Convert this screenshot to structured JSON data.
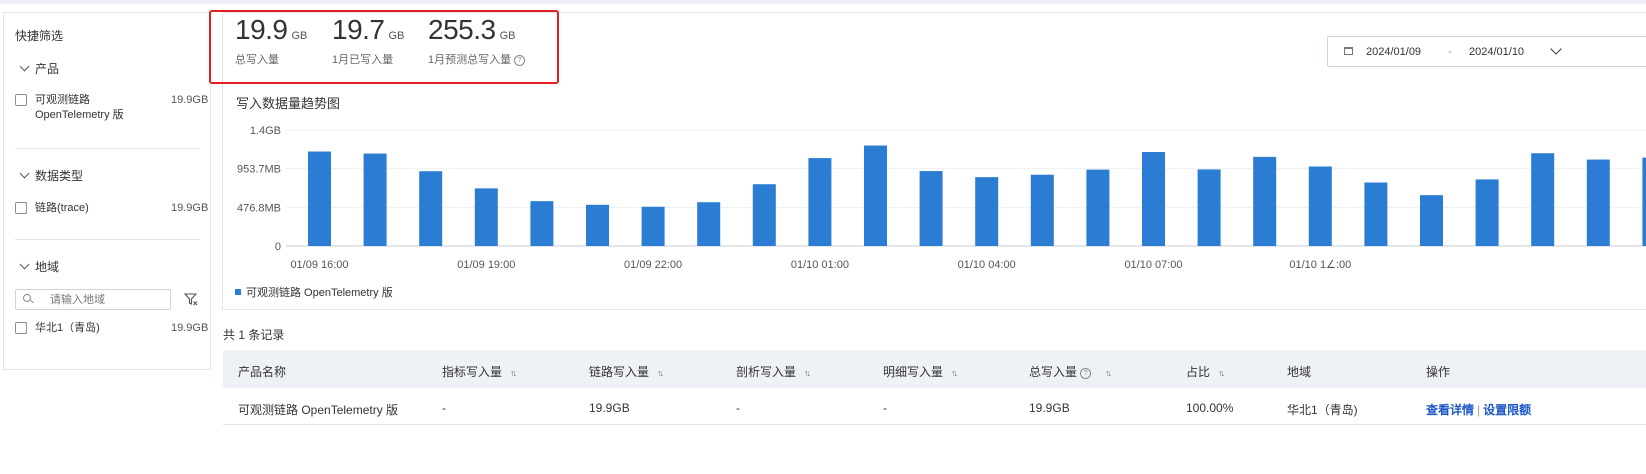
{
  "sidebar": {
    "title": "快捷筛选",
    "sections": [
      {
        "title": "产品",
        "items": [
          {
            "label_line1": "可观测链路",
            "label_line2": "OpenTelemetry 版",
            "count": "19.9GB"
          }
        ]
      },
      {
        "title": "数据类型",
        "items": [
          {
            "label": "链路(trace)",
            "count": "19.9GB"
          }
        ]
      },
      {
        "title": "地域",
        "search_placeholder": "请输入地域",
        "items": [
          {
            "label": "华北1（青岛)",
            "count": "19.9GB"
          }
        ]
      }
    ]
  },
  "stats": [
    {
      "value": "19.9",
      "unit": "GB",
      "label": "总写入量"
    },
    {
      "value": "19.7",
      "unit": "GB",
      "label": "1月已写入量"
    },
    {
      "value": "255.3",
      "unit": "GB",
      "label": "1月预测总写入量",
      "help": "?"
    }
  ],
  "date_range": {
    "start": "2024/01/09",
    "separator": "-",
    "end": "2024/01/10"
  },
  "chart_title": "写入数据量趋势图",
  "chart_data": {
    "type": "bar",
    "y_ticks": [
      "0",
      "476.8MB",
      "953.7MB",
      "1.4GB"
    ],
    "ylim_mb": [
      0,
      1430.5
    ],
    "x_tick_labels": [
      "01/09 16:00",
      "01/09 19:00",
      "01/09 22:00",
      "01/10 01:00",
      "01/10 04:00",
      "01/10 07:00",
      "01/10 1∠:00"
    ],
    "categories": [
      "01/09 16:00",
      "01/09 17:00",
      "01/09 18:00",
      "01/09 19:00",
      "01/09 20:00",
      "01/09 21:00",
      "01/09 22:00",
      "01/09 23:00",
      "01/10 00:00",
      "01/10 01:00",
      "01/10 02:00",
      "01/10 03:00",
      "01/10 04:00",
      "01/10 05:00",
      "01/10 06:00",
      "01/10 07:00",
      "01/10 08:00",
      "01/10 09:00",
      "01/10 10:00",
      "01/10 11:00",
      "01/10 12:00",
      "01/10 13:00",
      "01/10 14:00",
      "01/10 15:00",
      "01/10 16:00"
    ],
    "series": [
      {
        "name": "可观测链路 OpenTelemetry 版",
        "color": "#2b7cd3",
        "values": [
          1165,
          1140,
          922,
          711,
          553,
          508,
          484,
          540,
          762,
          1084,
          1239,
          924,
          849,
          879,
          942,
          1159,
          944,
          1099,
          980,
          783,
          627,
          821,
          1144,
          1066,
          1090
        ]
      }
    ],
    "grid": true,
    "legend": "bottom-left"
  },
  "records_text": "共 1 条记录",
  "table": {
    "columns": [
      {
        "label": "产品名称",
        "sortable": false
      },
      {
        "label": "指标写入量",
        "sortable": true
      },
      {
        "label": "链路写入量",
        "sortable": true
      },
      {
        "label": "剖析写入量",
        "sortable": true
      },
      {
        "label": "明细写入量",
        "sortable": true
      },
      {
        "label": "总写入量",
        "sortable": true,
        "help": "?"
      },
      {
        "label": "占比",
        "sortable": true
      },
      {
        "label": "地域",
        "sortable": false
      },
      {
        "label": "操作",
        "sortable": false
      }
    ],
    "sort_glyph": "↑↓",
    "rows": [
      {
        "product": "可观测链路 OpenTelemetry 版",
        "metric": "-",
        "trace": "19.9GB",
        "profile": "-",
        "detail": "-",
        "total": "19.9GB",
        "ratio": "100.00%",
        "region": "华北1（青岛)",
        "action_details": "查看详情",
        "action_sep": "|",
        "action_limit": "设置限额"
      }
    ]
  }
}
